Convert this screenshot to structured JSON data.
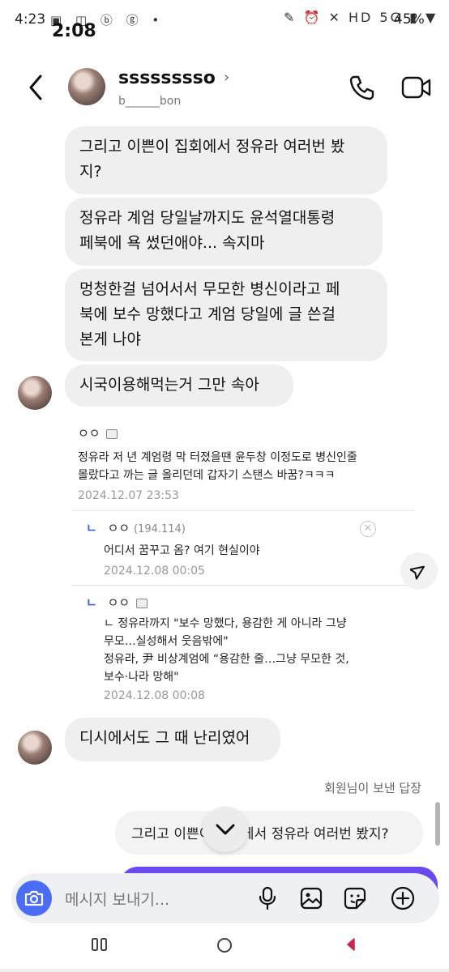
{
  "status": {
    "time": "4:23",
    "overlay_time": "2:08",
    "left_icons": "▣ ◫ ⓑ ⓖ •",
    "right_icons": "✎ ⏰ ✕ HD 5G ▮ ▼",
    "battery": "45%"
  },
  "header": {
    "name": "sssssssso",
    "username": "b______bon"
  },
  "messages": [
    {
      "text_lines": [
        "그리고 이쁜이 집회에서 정유라 여러번 봤",
        "지?"
      ]
    },
    {
      "text_lines": [
        "정유라 계엄 당일날까지도 윤석열대통령",
        "페북에 욕 썼던애야... 속지마"
      ]
    },
    {
      "text_lines": [
        "멍청한걸 넘어서서 무모한 병신이라고 페",
        "북에 보수 망했다고 계엄 당일에 글 쓴걸",
        "본게 나야"
      ]
    },
    {
      "text_lines": [
        "시국이용해먹는거 그만 속아"
      ]
    },
    {
      "text_lines": [
        "디시에서도 그 때 난리였어"
      ]
    }
  ],
  "quoted_post": {
    "author": "ㅇㅇ",
    "text_lines": [
      "정유라 저 년 계엄령 막 터졌을땐 윤두창 이정도로 병신인줄",
      "몰랐다고 까는 글 올리던데 갑자기 스탠스 바꿈?ㅋㅋㅋ"
    ],
    "date": "2024.12.07 23:53",
    "replies": [
      {
        "marker": "ㄴ",
        "author": "ㅇㅇ",
        "ip": "(194.114)",
        "text_lines": [
          "어디서 꿈꾸고 옴? 여기 현실이야"
        ],
        "date": "2024.12.08 00:05"
      },
      {
        "marker": "ㄴ",
        "author": "ㅇㅇ",
        "ip": "",
        "text_lines": [
          "ㄴ 정유라까지 \"보수 망했다, 용감한 게 아니라 그냥",
          "무모…실성해서 웃음밖에\"",
          "정유라, 尹 비상계엄에 “용감한 줄…그냥 무모한 것,",
          "보수·나라 망해\""
        ],
        "date": "2024.12.08 00:08"
      }
    ]
  },
  "reply_info": {
    "label": "회원님이 보낸 답장",
    "quoted_text": "그리고 이쁜이 집회에서 정유라 여러번 봤지?"
  },
  "composer": {
    "placeholder": "메시지 보내기..."
  },
  "colors": {
    "accent": "#4a6cf7",
    "bubble": "#efefef",
    "outgoing": "#6a4af0"
  }
}
